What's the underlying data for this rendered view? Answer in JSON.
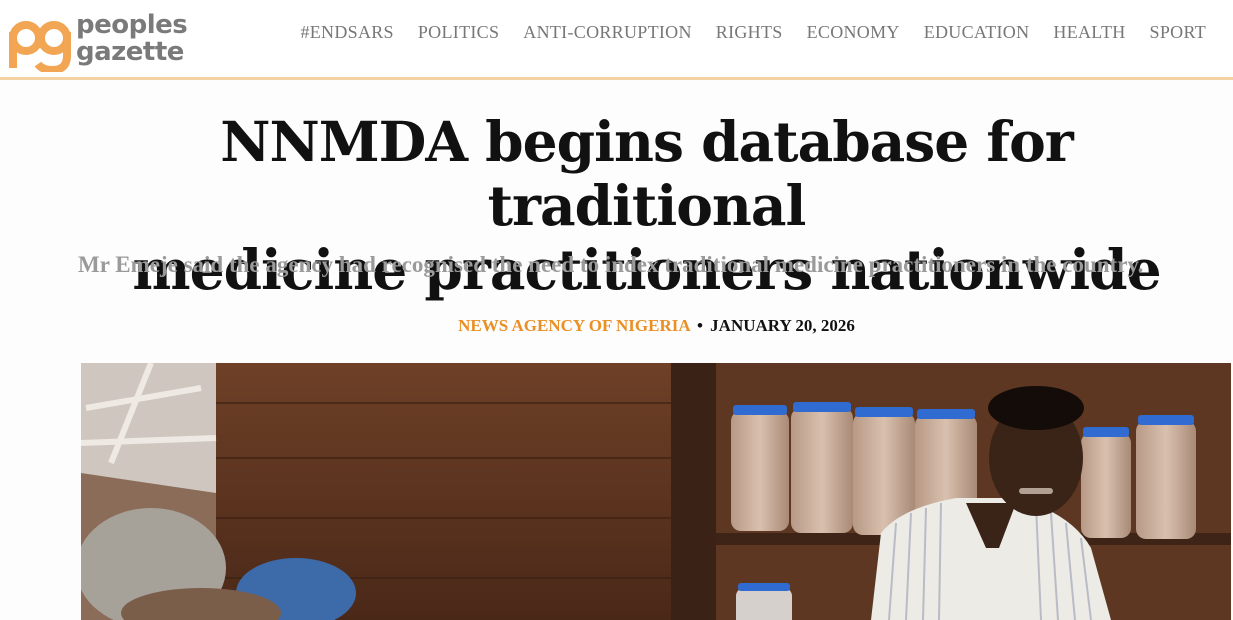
{
  "site": {
    "logo_line1": "peoples",
    "logo_line2": "gazette",
    "logo_mark": "pg"
  },
  "nav": {
    "items": [
      "#ENDSARS",
      "POLITICS",
      "ANTI-CORRUPTION",
      "RIGHTS",
      "ECONOMY",
      "EDUCATION",
      "HEALTH",
      "SPORT"
    ]
  },
  "article": {
    "headline_line1": "NNMDA begins database for traditional",
    "headline_line2": "medicine practitioners nationwide",
    "subtitle": "Mr Emeje said the agency had recognised the need to index traditional medicine practitioners in the country.",
    "source": "NEWS AGENCY OF NIGERIA",
    "separator": "•",
    "date": "JANUARY 20, 2026"
  },
  "colors": {
    "brand_orange": "#f2a552",
    "source_orange": "#e98f24",
    "header_border": "#f3d3a2"
  }
}
